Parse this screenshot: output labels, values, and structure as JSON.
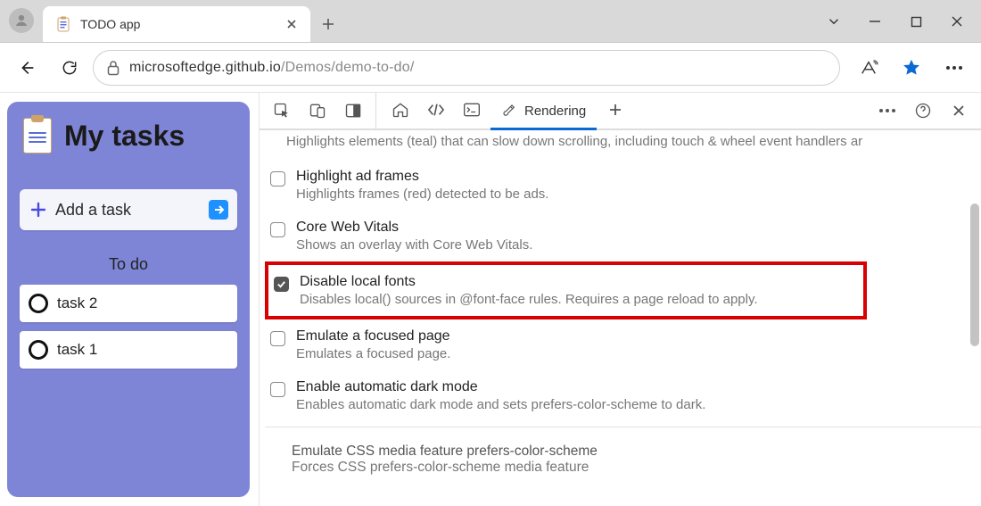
{
  "tab": {
    "title": "TODO app"
  },
  "url": {
    "host": "microsoftedge.github.io",
    "path": "/Demos/demo-to-do/"
  },
  "app": {
    "title": "My tasks",
    "add_label": "Add a task",
    "section_label": "To do",
    "tasks": [
      "task 2",
      "task 1"
    ]
  },
  "devtools": {
    "active_tab_label": "Rendering",
    "scroll_hint": "Highlights elements (teal) that can slow down scrolling, including touch & wheel event handlers ar",
    "options": [
      {
        "title": "Highlight ad frames",
        "desc": "Highlights frames (red) detected to be ads.",
        "checked": false
      },
      {
        "title": "Core Web Vitals",
        "desc": "Shows an overlay with Core Web Vitals.",
        "checked": false
      },
      {
        "title": "Disable local fonts",
        "desc": "Disables local() sources in @font-face rules. Requires a page reload to apply.",
        "checked": true
      },
      {
        "title": "Emulate a focused page",
        "desc": "Emulates a focused page.",
        "checked": false
      },
      {
        "title": "Enable automatic dark mode",
        "desc": "Enables automatic dark mode and sets prefers-color-scheme to dark.",
        "checked": false
      }
    ],
    "emulate_section": {
      "title": "Emulate CSS media feature prefers-color-scheme",
      "desc": "Forces CSS prefers-color-scheme media feature"
    }
  }
}
